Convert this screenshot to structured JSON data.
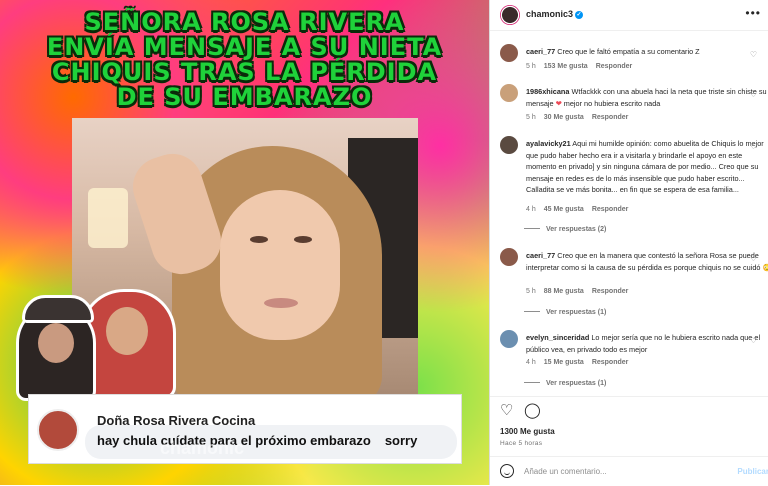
{
  "post": {
    "headline_lines": [
      "SEÑORA ROSA RIVERA",
      "ENVÍA MENSAJE A SU NIETA",
      "CHIQUIS TRAS LA PÉRDIDA",
      "DE SU EMBARAZO"
    ],
    "comment_card": {
      "name": "Doña Rosa Rivera Cocina",
      "text_main": "hay chula cuídate para el próximo embarazo",
      "text_extra": "sorry"
    },
    "watermark": "chamonic"
  },
  "panel": {
    "username": "chamonic3",
    "verified": "✓",
    "more": "•••",
    "comments": [
      {
        "user": "caeri_77",
        "text": "Creo que le faltó empatía a su comentario Z",
        "time": "5 h",
        "likes": "153 Me gusta",
        "reply": "Responder",
        "avatar_color": "#8a5a4a"
      },
      {
        "user": "1986xhicana",
        "text_before": "Wtfackkk con una abuela haci la neta que triste sin chiste su mensaje",
        "heart": "❤",
        "text_after": "mejor no hubiera escrito nada",
        "time": "5 h",
        "likes": "30 Me gusta",
        "reply": "Responder",
        "avatar_color": "#c9a07a"
      },
      {
        "user": "ayalavicky21",
        "text": "Aqui mi humilde opinión: como abuelita de Chiquis lo mejor que pudo haber hecho era ir a visitarla y brindarle el apoyo en este momento en privado] y sin ninguna cámara de por medio... Creo que su mensaje en redes es de lo más insensible que pudo haber escrito... Calladita se ve más bonita... en fin que se espera de esa familia...",
        "time": "4 h",
        "likes": "45 Me gusta",
        "reply": "Responder",
        "replies": "Ver respuestas (2)",
        "avatar_color": "#5a4a40"
      },
      {
        "user": "caeri_77",
        "text": "Creo que en la manera que contestó la señora Rosa se puede interpretar como si la causa de su pérdida es porque chiquis no se cuidó 😳",
        "time": "5 h",
        "likes": "88 Me gusta",
        "reply": "Responder",
        "replies": "Ver respuestas (1)",
        "avatar_color": "#8a5a4a"
      },
      {
        "user": "evelyn_sinceridad",
        "text": "Lo mejor sería que no le hubiera escrito nada que el público vea, en privado todo es mejor",
        "time": "4 h",
        "likes": "15 Me gusta",
        "reply": "Responder",
        "replies": "Ver respuestas (1)",
        "avatar_color": "#6b8fb0"
      }
    ],
    "likes_total": "1300 Me gusta",
    "time_ago": "Hace 5 horas",
    "add_comment_placeholder": "Añade un comentario...",
    "post_button": "Publicar"
  },
  "icons": [
    "heart-icon",
    "comment-icon",
    "emoji-icon",
    "more-options-icon",
    "verified-badge-icon"
  ]
}
